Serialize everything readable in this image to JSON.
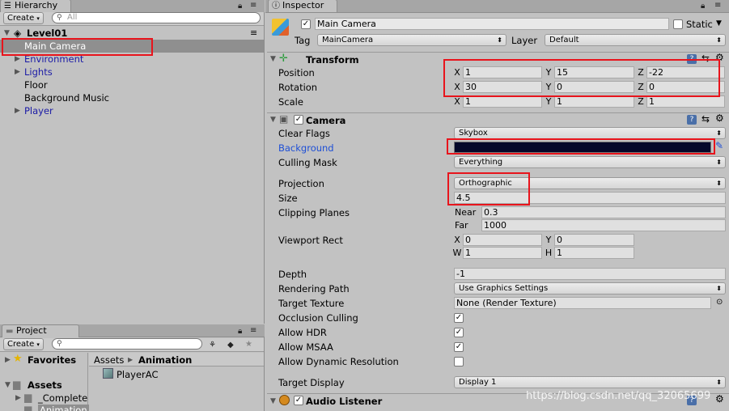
{
  "hierarchy": {
    "tab_label": "Hierarchy",
    "create_label": "Create",
    "search_placeholder": "All",
    "scene_name": "Level01",
    "items": [
      {
        "label": "Main Camera",
        "selected": true
      },
      {
        "label": "Environment",
        "expandable": true,
        "prefab": true
      },
      {
        "label": "Lights",
        "expandable": true,
        "prefab": true
      },
      {
        "label": "Floor"
      },
      {
        "label": "Background Music"
      },
      {
        "label": "Player",
        "expandable": true,
        "prefab": true
      }
    ]
  },
  "project": {
    "tab_label": "Project",
    "create_label": "Create",
    "favorites_label": "Favorites",
    "assets_label": "Assets",
    "folders": [
      "_Complete",
      "Animation"
    ],
    "breadcrumb": [
      "Assets",
      "Animation"
    ],
    "asset_item": "PlayerAC"
  },
  "inspector": {
    "tab_label": "Inspector",
    "object_name": "Main Camera",
    "static_label": "Static",
    "tag_label": "Tag",
    "tag_value": "MainCamera",
    "layer_label": "Layer",
    "layer_value": "Default",
    "transform": {
      "title": "Transform",
      "position_label": "Position",
      "rotation_label": "Rotation",
      "scale_label": "Scale",
      "axes": [
        "X",
        "Y",
        "Z"
      ],
      "position": [
        "1",
        "15",
        "-22"
      ],
      "rotation": [
        "30",
        "0",
        "0"
      ],
      "scale": [
        "1",
        "1",
        "1"
      ]
    },
    "camera": {
      "title": "Camera",
      "clear_flags_label": "Clear Flags",
      "clear_flags_value": "Skybox",
      "background_label": "Background",
      "background_color": "#05082a",
      "culling_mask_label": "Culling Mask",
      "culling_mask_value": "Everything",
      "projection_label": "Projection",
      "projection_value": "Orthographic",
      "size_label": "Size",
      "size_value": "4.5",
      "clipping_label": "Clipping Planes",
      "near_label": "Near",
      "near_value": "0.3",
      "far_label": "Far",
      "far_value": "1000",
      "viewport_label": "Viewport Rect",
      "vp_x_label": "X",
      "vp_x": "0",
      "vp_y_label": "Y",
      "vp_y": "0",
      "vp_w_label": "W",
      "vp_w": "1",
      "vp_h_label": "H",
      "vp_h": "1",
      "depth_label": "Depth",
      "depth_value": "-1",
      "rendering_path_label": "Rendering Path",
      "rendering_path_value": "Use Graphics Settings",
      "target_texture_label": "Target Texture",
      "target_texture_value": "None (Render Texture)",
      "occlusion_label": "Occlusion Culling",
      "hdr_label": "Allow HDR",
      "msaa_label": "Allow MSAA",
      "dynres_label": "Allow Dynamic Resolution",
      "target_display_label": "Target Display",
      "target_display_value": "Display 1"
    },
    "audio_listener": {
      "title": "Audio Listener"
    }
  },
  "watermark": "https://blog.csdn.net/qq_32065699",
  "colors": {
    "selection": "#8f8f8f",
    "highlight_box": "#e8141c",
    "prefab_text": "#1a1aa6",
    "link_blue": "#1e4fd6"
  }
}
